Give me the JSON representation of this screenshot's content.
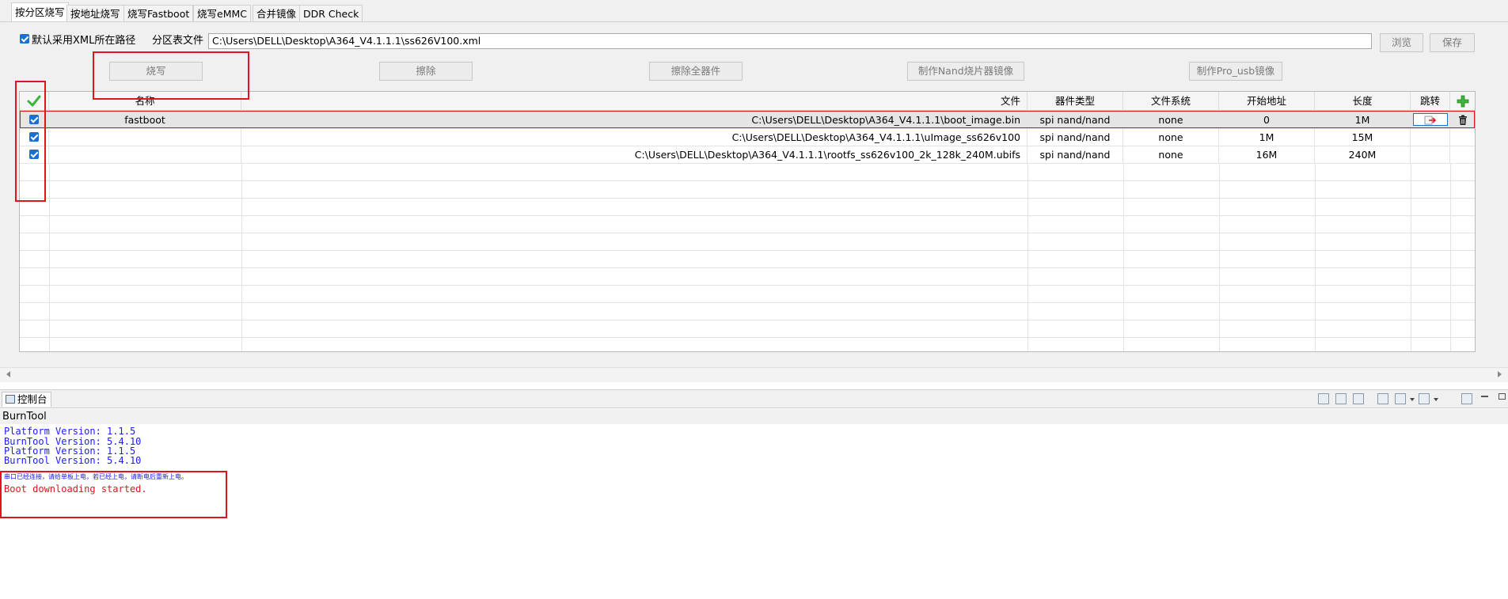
{
  "tabs": [
    "按分区烧写",
    "按地址烧写",
    "烧写Fastboot",
    "烧写eMMC",
    "合并镜像",
    "DDR Check"
  ],
  "options": {
    "use_xml_path_label": "默认采用XML所在路径",
    "partition_file_label": "分区表文件",
    "partition_file_value": "C:\\Users\\DELL\\Desktop\\A364_V4.1.1.1\\ss626V100.xml",
    "browse": "浏览",
    "save": "保存"
  },
  "actions": {
    "burn": "烧写",
    "erase": "擦除",
    "erase_all": "擦除全器件",
    "make_nand_image": "制作Nand烧片器镜像",
    "make_pro_usb_image": "制作Pro_usb镜像"
  },
  "table": {
    "headers": {
      "name": "名称",
      "file": "文件",
      "device": "器件类型",
      "fs": "文件系统",
      "start": "开始地址",
      "length": "长度",
      "jump": "跳转"
    },
    "rows": [
      {
        "name": "fastboot",
        "file": "C:\\Users\\DELL\\Desktop\\A364_V4.1.1.1\\boot_image.bin",
        "device": "spi nand/nand",
        "fs": "none",
        "start": "0",
        "length": "1M"
      },
      {
        "name": "",
        "file": "C:\\Users\\DELL\\Desktop\\A364_V4.1.1.1\\uImage_ss626v100",
        "device": "spi nand/nand",
        "fs": "none",
        "start": "1M",
        "length": "15M"
      },
      {
        "name": "",
        "file": "C:\\Users\\DELL\\Desktop\\A364_V4.1.1.1\\rootfs_ss626v100_2k_128k_240M.ubifs",
        "device": "spi nand/nand",
        "fs": "none",
        "start": "16M",
        "length": "240M"
      }
    ]
  },
  "console": {
    "tab_label": "控制台",
    "name": "BurnTool",
    "lines": [
      {
        "text": "Platform Version: 1.1.5",
        "color": "#1a1aff"
      },
      {
        "text": "BurnTool Version: 5.4.10",
        "color": "#1a1aff"
      },
      {
        "text": "Platform Version: 1.1.5",
        "color": "#1a1aff"
      },
      {
        "text": "BurnTool Version: 5.4.10",
        "color": "#1a1aff"
      },
      {
        "text": "串口已经连接，请给单板上电，若已经上电，请断电后重新上电。",
        "color": "#1a1aff"
      },
      {
        "text": "Boot downloading started.",
        "color": "#e0141e"
      }
    ]
  },
  "colors": {
    "highlight": "#e0141e",
    "accent": "#1a6fd1",
    "add": "#3cb43c"
  }
}
